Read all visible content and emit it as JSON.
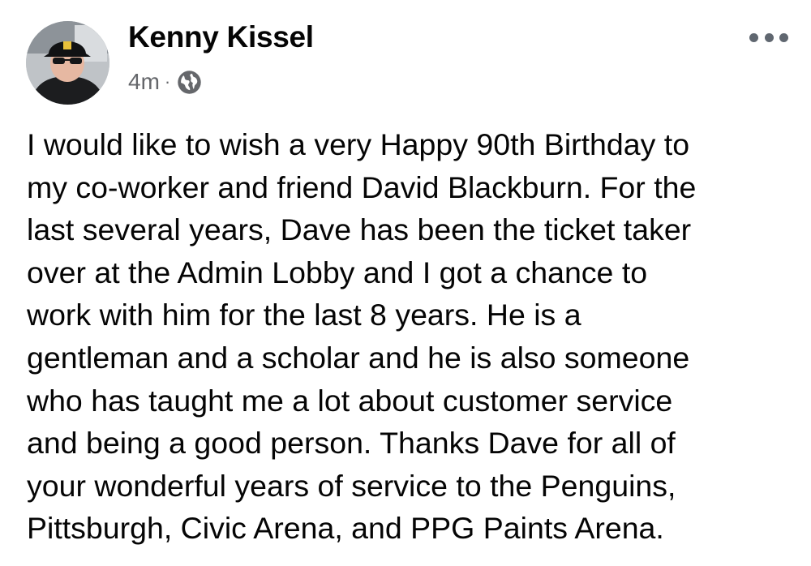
{
  "post": {
    "author": "Kenny Kissel",
    "timestamp": "4m",
    "separator": "·",
    "privacy_icon": "globe-icon",
    "more_icon": "more-options-icon",
    "body_lines": [
      "I would like to wish a very Happy 90th Birthday to",
      "my co-worker and friend David Blackburn. For the",
      "last several years, Dave has been the ticket taker",
      "over at the Admin Lobby and I got a chance to",
      "work with him for the last 8 years. He is a",
      "gentleman and a scholar and he is also someone",
      "who has taught me a lot about customer service",
      "and being a good person. Thanks Dave for all of",
      "your wonderful years of service to the Penguins,",
      "Pittsburgh, Civic Arena, and PPG Paints Arena."
    ]
  },
  "colors": {
    "text_primary": "#050505",
    "text_secondary": "#65676b",
    "background": "#ffffff"
  }
}
